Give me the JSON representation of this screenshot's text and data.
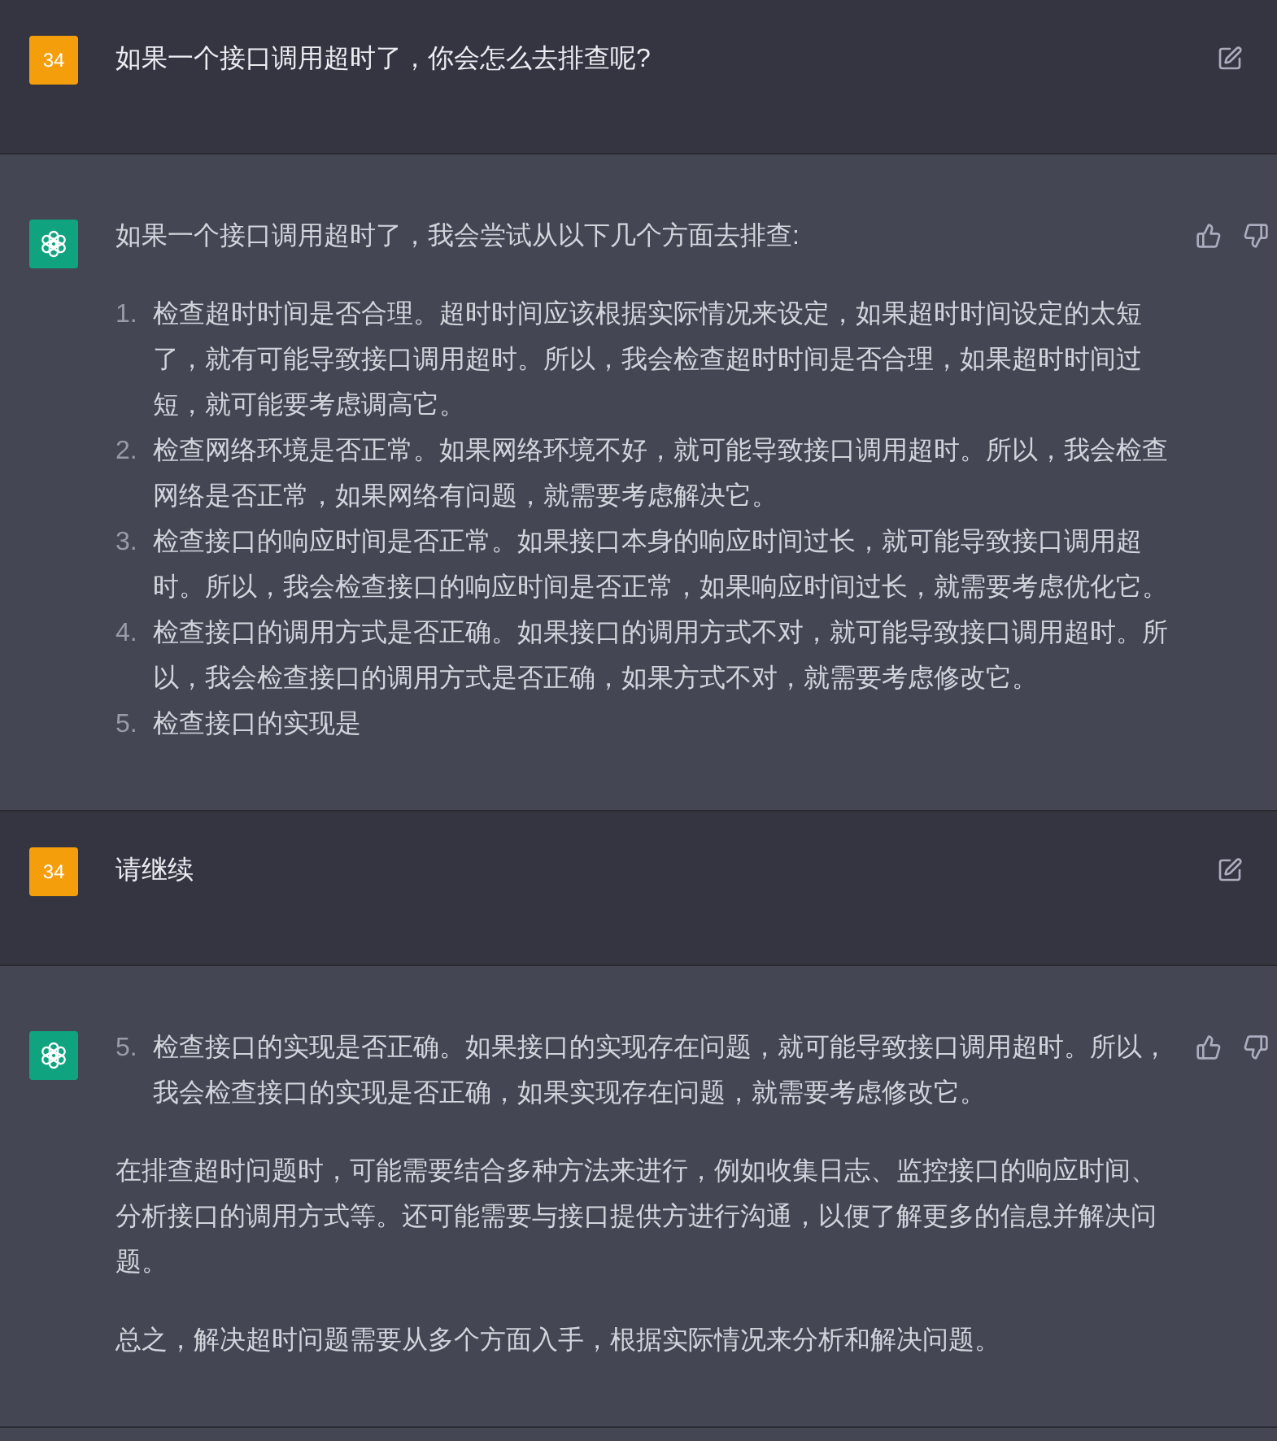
{
  "messages": [
    {
      "kind": "user",
      "avatar": "34",
      "text": "如果一个接口调用超时了，你会怎么去排查呢?"
    },
    {
      "kind": "assistant",
      "blocks": [
        {
          "kind": "paragraph",
          "text": "如果一个接口调用超时了，我会尝试从以下几个方面去排查:"
        },
        {
          "kind": "list",
          "items": [
            {
              "number": "1.",
              "text": "检查超时时间是否合理。超时时间应该根据实际情况来设定，如果超时时间设定的太短了，就有可能导致接口调用超时。所以，我会检查超时时间是否合理，如果超时时间过短，就可能要考虑调高它。"
            },
            {
              "number": "2.",
              "text": "检查网络环境是否正常。如果网络环境不好，就可能导致接口调用超时。所以，我会检查网络是否正常，如果网络有问题，就需要考虑解决它。"
            },
            {
              "number": "3.",
              "text": "检查接口的响应时间是否正常。如果接口本身的响应时间过长，就可能导致接口调用超时。所以，我会检查接口的响应时间是否正常，如果响应时间过长，就需要考虑优化它。"
            },
            {
              "number": "4.",
              "text": "检查接口的调用方式是否正确。如果接口的调用方式不对，就可能导致接口调用超时。所以，我会检查接口的调用方式是否正确，如果方式不对，就需要考虑修改它。"
            },
            {
              "number": "5.",
              "text": "检查接口的实现是"
            }
          ]
        }
      ]
    },
    {
      "kind": "user",
      "avatar": "34",
      "text": "请继续"
    },
    {
      "kind": "assistant",
      "blocks": [
        {
          "kind": "list",
          "items": [
            {
              "number": "5.",
              "text": "检查接口的实现是否正确。如果接口的实现存在问题，就可能导致接口调用超时。所以，我会检查接口的实现是否正确，如果实现存在问题，就需要考虑修改它。"
            }
          ]
        },
        {
          "kind": "paragraph",
          "text": "在排查超时问题时，可能需要结合多种方法来进行，例如收集日志、监控接口的响应时间、分析接口的调用方式等。还可能需要与接口提供方进行沟通，以便了解更多的信息并解决问题。"
        },
        {
          "kind": "paragraph",
          "text": "总之，解决超时问题需要从多个方面入手，根据实际情况来分析和解决问题。"
        }
      ]
    }
  ]
}
